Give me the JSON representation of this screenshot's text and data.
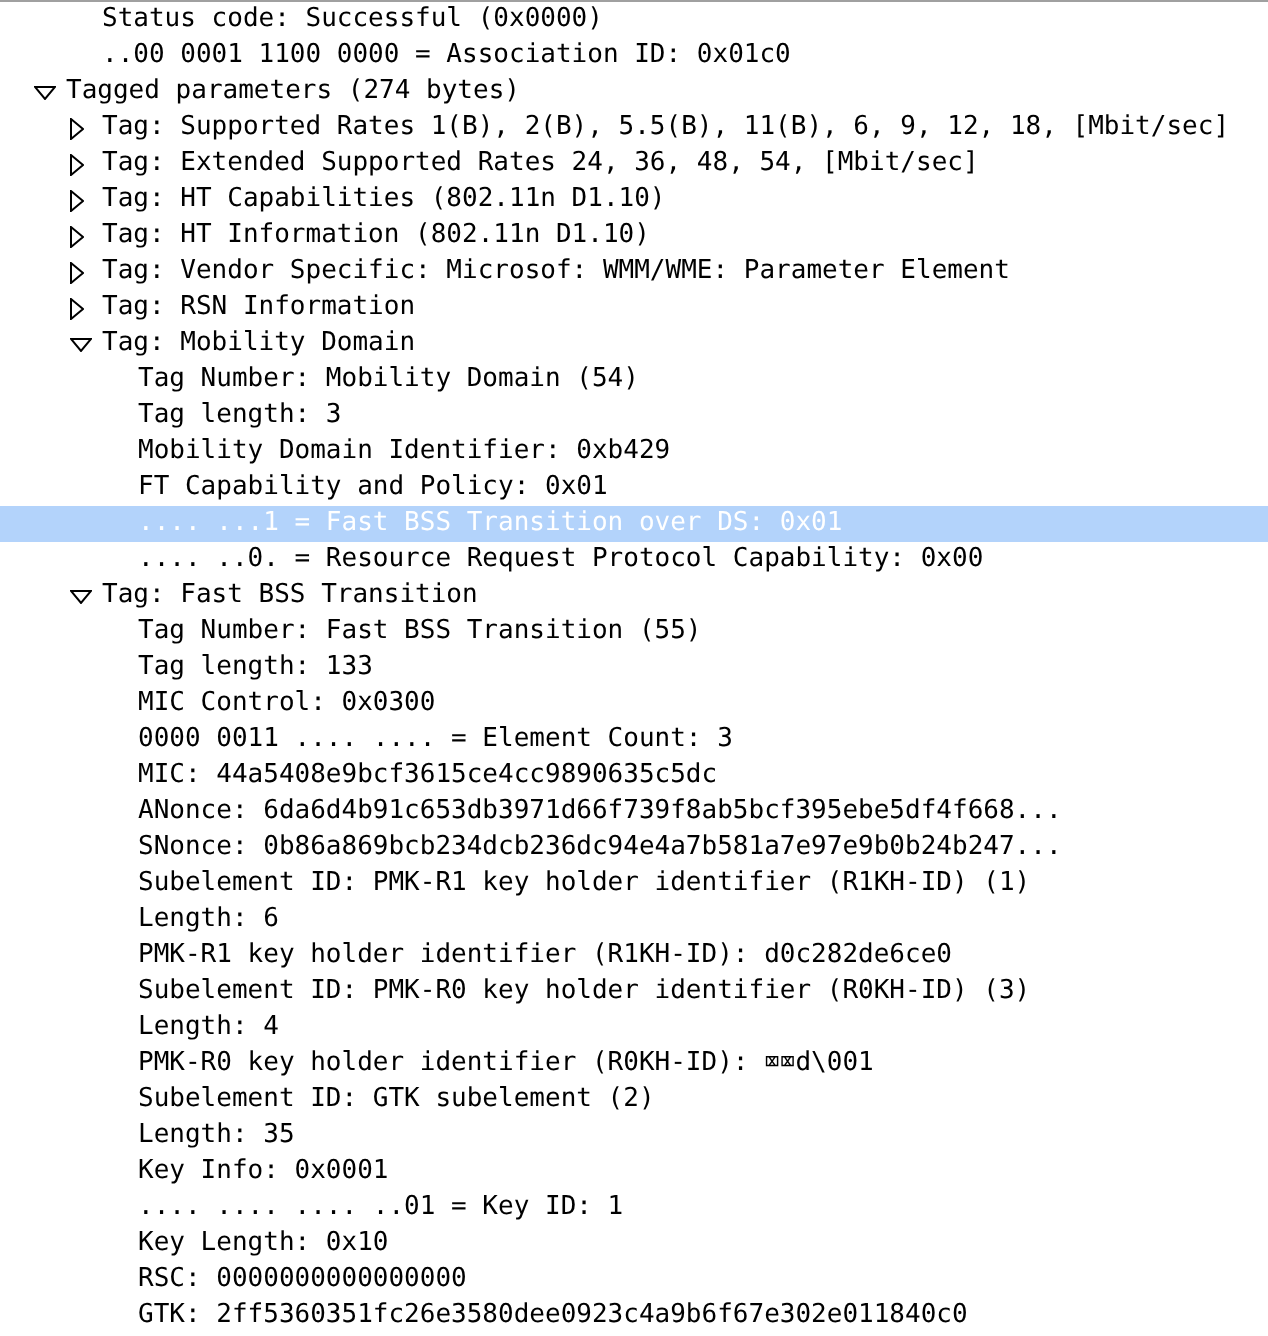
{
  "tree": [
    {
      "children": [
        {
          "label": "Status code: Successful (0x0000)",
          "selected": false
        },
        {
          "label": "..00 0001 1100 0000 = Association ID: 0x01c0",
          "selected": false
        }
      ]
    },
    {
      "label": "Tagged parameters (274 bytes)",
      "selected": false,
      "expanded": true,
      "children": [
        {
          "label": "Tag: Supported Rates 1(B), 2(B), 5.5(B), 11(B), 6, 9, 12, 18, [Mbit/sec]",
          "selected": false,
          "expanded": false
        },
        {
          "label": "Tag: Extended Supported Rates 24, 36, 48, 54, [Mbit/sec]",
          "selected": false,
          "expanded": false
        },
        {
          "label": "Tag: HT Capabilities (802.11n D1.10)",
          "selected": false,
          "expanded": false
        },
        {
          "label": "Tag: HT Information (802.11n D1.10)",
          "selected": false,
          "expanded": false
        },
        {
          "label": "Tag: Vendor Specific: Microsof: WMM/WME: Parameter Element",
          "selected": false,
          "expanded": false
        },
        {
          "label": "Tag: RSN Information",
          "selected": false,
          "expanded": false
        },
        {
          "label": "Tag: Mobility Domain",
          "selected": false,
          "expanded": true,
          "children": [
            {
              "label": "Tag Number: Mobility Domain (54)",
              "selected": false
            },
            {
              "label": "Tag length: 3",
              "selected": false
            },
            {
              "label": "Mobility Domain Identifier: 0xb429",
              "selected": false
            },
            {
              "label": "FT Capability and Policy: 0x01",
              "selected": false
            },
            {
              "label": ".... ...1 = Fast BSS Transition over DS: 0x01",
              "selected": true
            },
            {
              "label": ".... ..0. = Resource Request Protocol Capability: 0x00",
              "selected": false
            }
          ]
        },
        {
          "label": "Tag: Fast BSS Transition",
          "selected": false,
          "expanded": true,
          "children": [
            {
              "label": "Tag Number: Fast BSS Transition (55)",
              "selected": false
            },
            {
              "label": "Tag length: 133",
              "selected": false
            },
            {
              "label": "MIC Control: 0x0300",
              "selected": false
            },
            {
              "label": "0000 0011 .... .... = Element Count: 3",
              "selected": false
            },
            {
              "label": "MIC: 44a5408e9bcf3615ce4cc9890635c5dc",
              "selected": false
            },
            {
              "label": "ANonce: 6da6d4b91c653db3971d66f739f8ab5bcf395ebe5df4f668...",
              "selected": false
            },
            {
              "label": "SNonce: 0b86a869bcb234dcb236dc94e4a7b581a7e97e9b0b24b247...",
              "selected": false
            },
            {
              "label": "Subelement ID: PMK-R1 key holder identifier (R1KH-ID) (1)",
              "selected": false
            },
            {
              "label": "Length: 6",
              "selected": false
            },
            {
              "label": "PMK-R1 key holder identifier (R1KH-ID): d0c282de6ce0",
              "selected": false
            },
            {
              "label": "Subelement ID: PMK-R0 key holder identifier (R0KH-ID) (3)",
              "selected": false
            },
            {
              "label": "Length: 4",
              "selected": false
            },
            {
              "label": "PMK-R0 key holder identifier (R0KH-ID): ⌧⌧d\\001",
              "selected": false
            },
            {
              "label": "Subelement ID: GTK subelement (2)",
              "selected": false
            },
            {
              "label": "Length: 35",
              "selected": false
            },
            {
              "label": "Key Info: 0x0001",
              "selected": false
            },
            {
              "label": ".... .... .... ..01 = Key ID: 1",
              "selected": false
            },
            {
              "label": "Key Length: 0x10",
              "selected": false
            },
            {
              "label": "RSC: 0000000000000000",
              "selected": false
            },
            {
              "label": "GTK: 2ff5360351fc26e3580dee0923c4a9b6f67e302e011840c0",
              "selected": false
            }
          ]
        }
      ]
    }
  ]
}
